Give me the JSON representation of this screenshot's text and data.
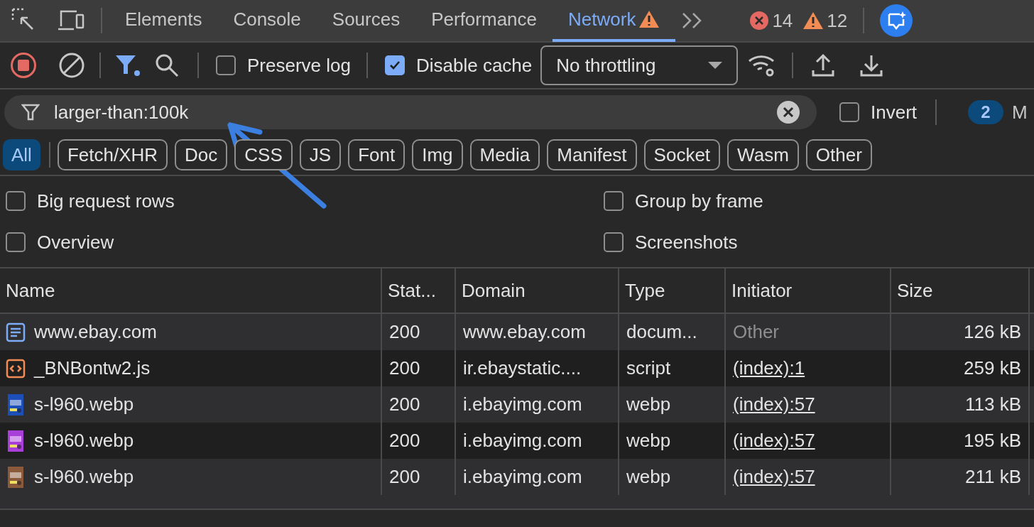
{
  "tabs": [
    {
      "label": "Elements",
      "selected": false,
      "warning": false
    },
    {
      "label": "Console",
      "selected": false,
      "warning": false
    },
    {
      "label": "Sources",
      "selected": false,
      "warning": false
    },
    {
      "label": "Performance",
      "selected": false,
      "warning": false
    },
    {
      "label": "Network",
      "selected": true,
      "warning": true
    }
  ],
  "error_count": "14",
  "warning_count": "12",
  "toolbar": {
    "recording": true,
    "filter_active": true,
    "preserve_log": {
      "label": "Preserve log",
      "checked": false
    },
    "disable_cache": {
      "label": "Disable cache",
      "checked": true
    },
    "throttling": "No throttling"
  },
  "filter": {
    "value": "larger-than:100k",
    "invert": {
      "label": "Invert",
      "checked": false
    },
    "badge": "2",
    "cut_label": "M"
  },
  "type_chips": [
    {
      "label": "All",
      "selected": true
    },
    {
      "label": "Fetch/XHR",
      "selected": false
    },
    {
      "label": "Doc",
      "selected": false
    },
    {
      "label": "CSS",
      "selected": false
    },
    {
      "label": "JS",
      "selected": false
    },
    {
      "label": "Font",
      "selected": false
    },
    {
      "label": "Img",
      "selected": false
    },
    {
      "label": "Media",
      "selected": false
    },
    {
      "label": "Manifest",
      "selected": false
    },
    {
      "label": "Socket",
      "selected": false
    },
    {
      "label": "Wasm",
      "selected": false
    },
    {
      "label": "Other",
      "selected": false
    }
  ],
  "options": [
    {
      "label": "Big request rows",
      "checked": false
    },
    {
      "label": "Group by frame",
      "checked": false
    },
    {
      "label": "Overview",
      "checked": false
    },
    {
      "label": "Screenshots",
      "checked": false
    }
  ],
  "table": {
    "columns": [
      "Name",
      "Stat...",
      "Domain",
      "Type",
      "Initiator",
      "Size"
    ],
    "rows": [
      {
        "kind": "document",
        "name": "www.ebay.com",
        "status": "200",
        "domain": "www.ebay.com",
        "type": "docum...",
        "initiator": "Other",
        "initiator_link": false,
        "size": "126 kB"
      },
      {
        "kind": "script",
        "name": "_BNBontw2.js",
        "status": "200",
        "domain": "ir.ebaystatic....",
        "type": "script",
        "initiator": "(index):1",
        "initiator_link": true,
        "size": "259 kB"
      },
      {
        "name": "s-l960.webp",
        "status": "200",
        "domain": "i.ebayimg.com",
        "type": "webp",
        "initiator": "(index):57",
        "initiator_link": true,
        "size": "113 kB",
        "color": "#1d4fb8"
      },
      {
        "name": "s-l960.webp",
        "status": "200",
        "domain": "i.ebayimg.com",
        "type": "webp",
        "initiator": "(index):57",
        "initiator_link": true,
        "size": "195 kB",
        "color": "#a83fd9"
      },
      {
        "name": "s-l960.webp",
        "status": "200",
        "domain": "i.ebayimg.com",
        "type": "webp",
        "initiator": "(index):57",
        "initiator_link": true,
        "size": "211 kB",
        "color": "#8a5a3a"
      }
    ]
  }
}
